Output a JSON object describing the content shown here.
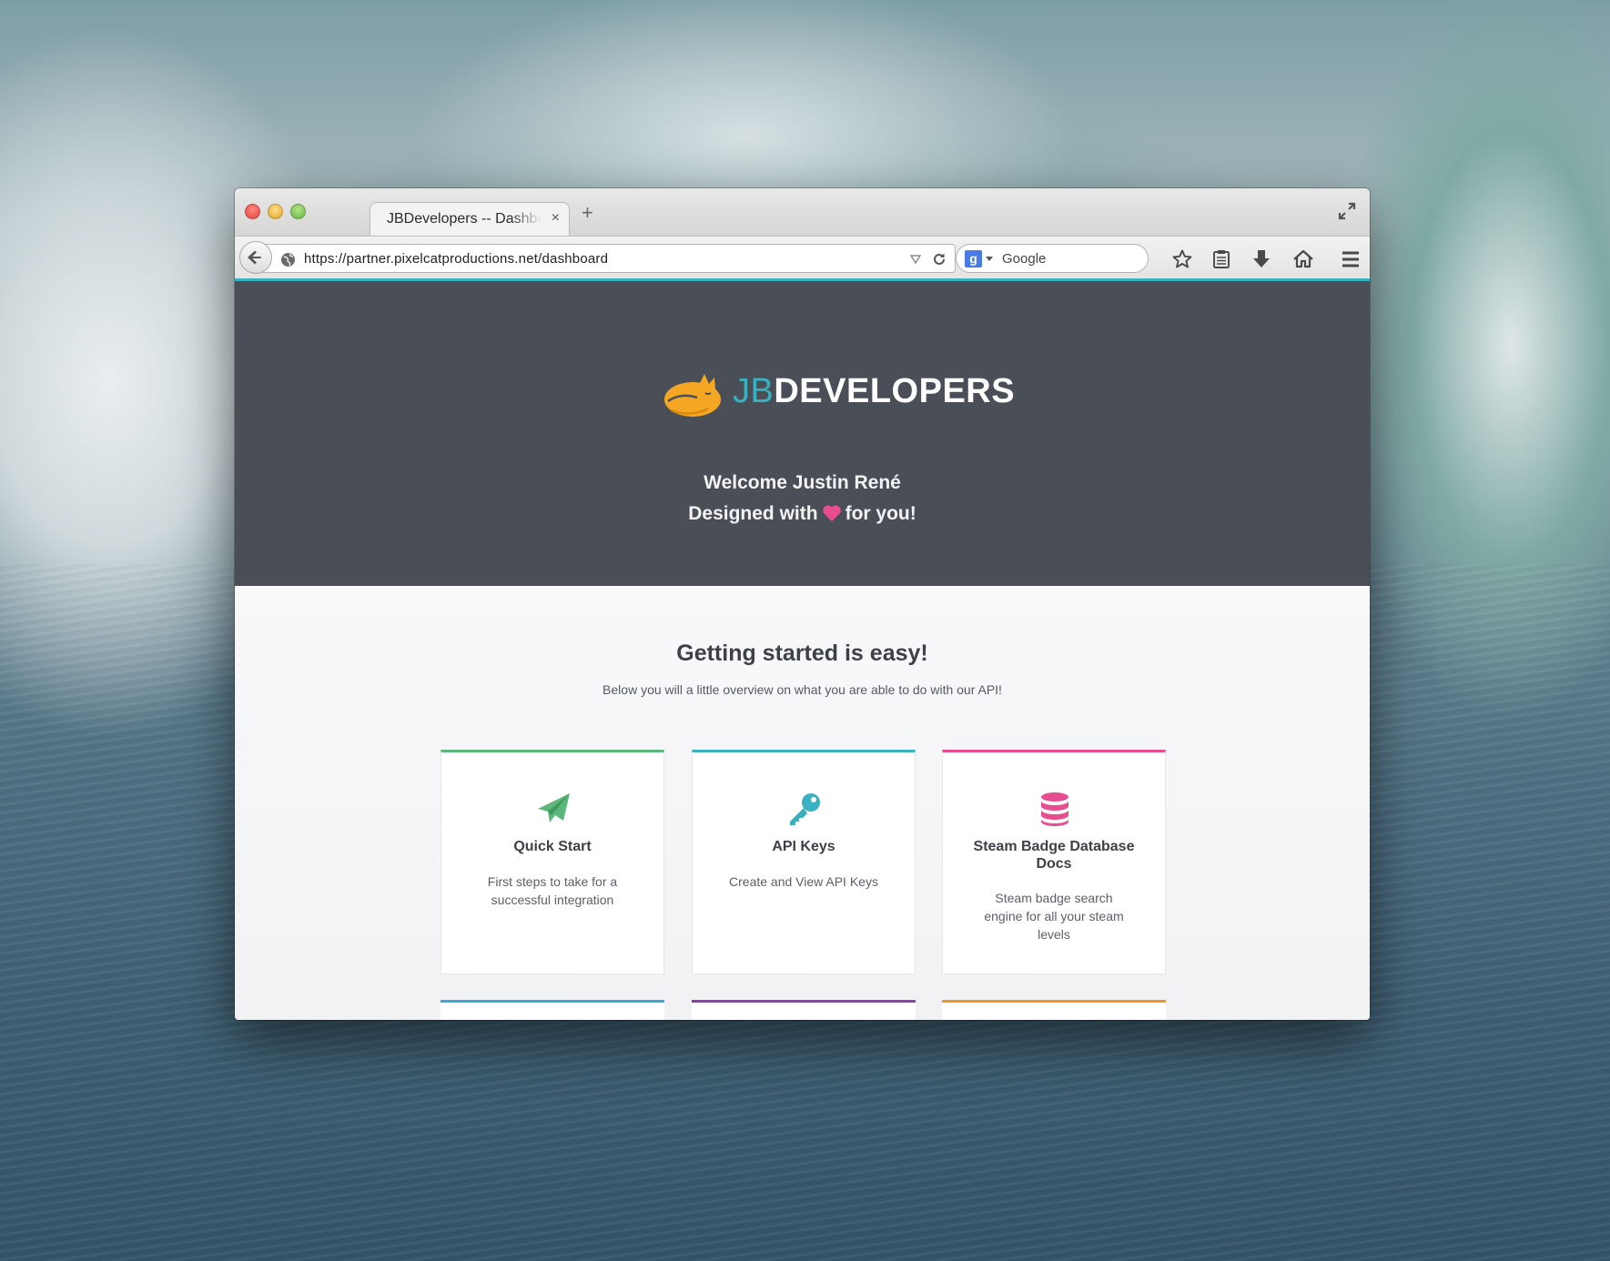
{
  "browser": {
    "tab_title": "JBDevelopers -- Dashboard",
    "tab_close": "×",
    "new_tab": "+",
    "url": "https://partner.pixelcatproductions.net/dashboard",
    "search_placeholder": "Google",
    "search_engine_letter": "g"
  },
  "hero": {
    "logo_jb": "JB",
    "logo_developers": "DEVELOPERS",
    "welcome": "Welcome Justin René",
    "designed_prefix": "Designed with",
    "designed_suffix": "for you!"
  },
  "main": {
    "heading": "Getting started is easy!",
    "subheading": "Below you will a little overview on what you are able to do with our API!",
    "cards": [
      {
        "title": "Quick Start",
        "description": "First steps to take for a successful integration",
        "icon": "paper-plane-icon",
        "color": "#5cb87a"
      },
      {
        "title": "API Keys",
        "description": "Create and View API Keys",
        "icon": "key-icon",
        "color": "#3ab1c0"
      },
      {
        "title": "Steam Badge Database Docs",
        "description": "Steam badge search engine for all your steam levels",
        "icon": "database-icon",
        "color": "#e84c91"
      }
    ],
    "peek_colors": [
      "#3aa7e0",
      "#8a3fb5",
      "#f39226"
    ]
  },
  "colors": {
    "accent": "#3ab1c0",
    "hero_bg": "#4a4f57",
    "logo_orange": "#f5a623",
    "heart": "#e84c91"
  }
}
